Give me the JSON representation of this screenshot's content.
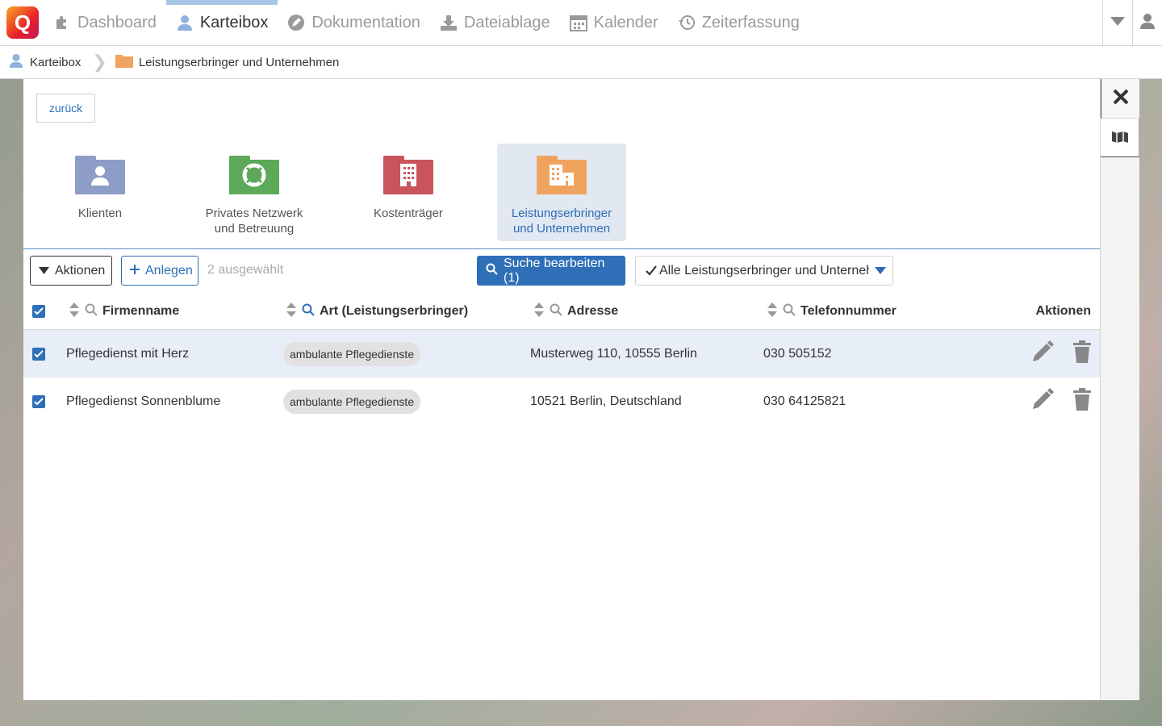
{
  "app": {
    "logo_letter": "Q"
  },
  "nav": {
    "items": [
      {
        "id": "dashboard",
        "label": "Dashboard",
        "icon": "puzzle-icon",
        "active": false
      },
      {
        "id": "karteibox",
        "label": "Karteibox",
        "icon": "user-icon",
        "active": true
      },
      {
        "id": "dokumentation",
        "label": "Dokumentation",
        "icon": "pencil-bubble-icon",
        "active": false
      },
      {
        "id": "dateiablage",
        "label": "Dateiablage",
        "icon": "download-icon",
        "active": false
      },
      {
        "id": "kalender",
        "label": "Kalender",
        "icon": "calendar-icon",
        "active": false
      },
      {
        "id": "zeiterfassung",
        "label": "Zeiterfassung",
        "icon": "history-icon",
        "active": false
      }
    ]
  },
  "breadcrumb": {
    "root": "Karteibox",
    "current": "Leistungserbringer und Unternehmen"
  },
  "back_label": "zurück",
  "categories": [
    {
      "line1": "Klienten",
      "line2": "",
      "color": "#8e9dc8",
      "icon": "person-icon",
      "active": false
    },
    {
      "line1": "Privates Netzwerk",
      "line2": "und Betreuung",
      "color": "#5ea85a",
      "icon": "lifebuoy-icon",
      "active": false
    },
    {
      "line1": "Kostenträger",
      "line2": "",
      "color": "#c9545b",
      "icon": "building-icon",
      "active": false
    },
    {
      "line1": "Leistungserbringer",
      "line2": "und Unternehmen",
      "color": "#f0a35e",
      "icon": "office-icon",
      "active": true
    }
  ],
  "toolbar": {
    "actions_label": "Aktionen",
    "create_label": "Anlegen",
    "selected_label": "2 ausgewählt",
    "search_label": "Suche bearbeiten (1)",
    "filter_label": "Alle Leistungserbringer und Unternehmen"
  },
  "table": {
    "columns": [
      "Firmenname",
      "Art (Leistungserbringer)",
      "Adresse",
      "Telefonnummer",
      "Aktionen"
    ],
    "rows": [
      {
        "name": "Pflegedienst mit Herz",
        "type": "ambulante Pflegedienste",
        "address": "Musterweg 110, 10555 Berlin",
        "phone": "030 505152",
        "checked": true
      },
      {
        "name": "Pflegedienst Sonnenblume",
        "type": "ambulante Pflegedienste",
        "address": "10521 Berlin, Deutschland",
        "phone": "030 64125821",
        "checked": true
      }
    ]
  },
  "colors": {
    "accent": "#2f6fb7",
    "active_tab": "#a8c6e8"
  }
}
